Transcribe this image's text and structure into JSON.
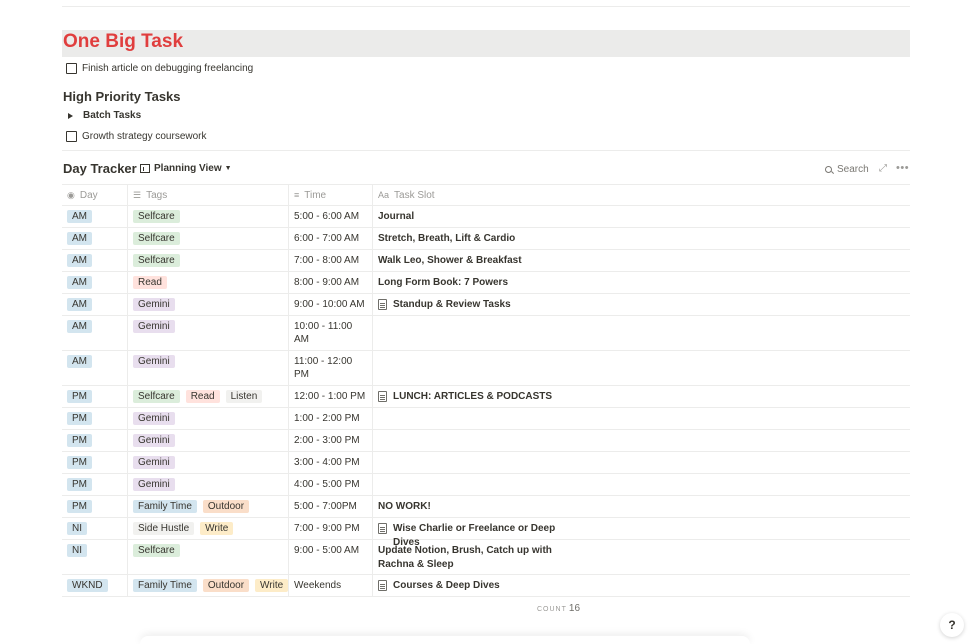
{
  "big_task": {
    "title": "One Big Task",
    "todo": "Finish article on debugging freelancing"
  },
  "high_priority": {
    "title": "High Priority Tasks",
    "toggle": "Batch Tasks",
    "todo": "Growth strategy coursework"
  },
  "database": {
    "title": "Day Tracker",
    "view_label": "Planning View",
    "search_label": "Search",
    "count_label": "COUNT",
    "count_value": "16",
    "columns": {
      "day": "Day",
      "tags": "Tags",
      "time": "Time",
      "task": "Task Slot"
    }
  },
  "colors": {
    "title_red": "#e03e3e",
    "day_bg": "#d3e5ef",
    "selfcare_bg": "#dbeddb",
    "read_bg": "#ffe2dd",
    "gemini_bg": "#e8deee",
    "listen_bg": "#f1f1ef",
    "family_bg": "#d3e5ef",
    "outdoor_bg": "#fadec9",
    "side_hustle_bg": "#f1f1ef",
    "write_bg": "#fdecc8"
  },
  "rows": [
    {
      "day": "AM",
      "tags": [
        "Selfcare"
      ],
      "time": "5:00 - 6:00 AM",
      "task": "Journal",
      "page": false
    },
    {
      "day": "AM",
      "tags": [
        "Selfcare"
      ],
      "time": "6:00 - 7:00 AM",
      "task": "Stretch, Breath, Lift & Cardio",
      "page": false
    },
    {
      "day": "AM",
      "tags": [
        "Selfcare"
      ],
      "time": "7:00 - 8:00 AM",
      "task": "Walk Leo, Shower & Breakfast",
      "page": false
    },
    {
      "day": "AM",
      "tags": [
        "Read"
      ],
      "time": "8:00 - 9:00 AM",
      "task": "Long Form Book: 7 Powers",
      "page": false
    },
    {
      "day": "AM",
      "tags": [
        "Gemini"
      ],
      "time": "9:00 - 10:00 AM",
      "task": "Standup & Review Tasks",
      "page": true
    },
    {
      "day": "AM",
      "tags": [
        "Gemini"
      ],
      "time": "10:00 - 11:00 AM",
      "task": "",
      "page": false
    },
    {
      "day": "AM",
      "tags": [
        "Gemini"
      ],
      "time": "11:00 - 12:00 PM",
      "task": "",
      "page": false
    },
    {
      "day": "PM",
      "tags": [
        "Selfcare",
        "Read",
        "Listen"
      ],
      "time": "12:00 - 1:00 PM",
      "task": "LUNCH: ARTICLES & PODCASTS",
      "page": true
    },
    {
      "day": "PM",
      "tags": [
        "Gemini"
      ],
      "time": "1:00 - 2:00 PM",
      "task": "",
      "page": false
    },
    {
      "day": "PM",
      "tags": [
        "Gemini"
      ],
      "time": "2:00 - 3:00 PM",
      "task": "",
      "page": false
    },
    {
      "day": "PM",
      "tags": [
        "Gemini"
      ],
      "time": "3:00 - 4:00 PM",
      "task": "",
      "page": false
    },
    {
      "day": "PM",
      "tags": [
        "Gemini"
      ],
      "time": "4:00 - 5:00 PM",
      "task": "",
      "page": false
    },
    {
      "day": "PM",
      "tags": [
        "Family Time",
        "Outdoor"
      ],
      "time": "5:00 - 7:00PM",
      "task": "NO WORK!",
      "page": false
    },
    {
      "day": "NI",
      "tags": [
        "Side Hustle",
        "Write"
      ],
      "time": "7:00 - 9:00 PM",
      "task": "Wise Charlie or Freelance or Deep Dives",
      "page": true
    },
    {
      "day": "NI",
      "tags": [
        "Selfcare"
      ],
      "time": "9:00 - 5:00 AM",
      "task": "Update Notion, Brush, Catch up with Rachna & Sleep",
      "page": false
    },
    {
      "day": "WKND",
      "tags": [
        "Family Time",
        "Outdoor",
        "Write"
      ],
      "time": "Weekends",
      "task": "Courses & Deep Dives",
      "page": true
    }
  ]
}
